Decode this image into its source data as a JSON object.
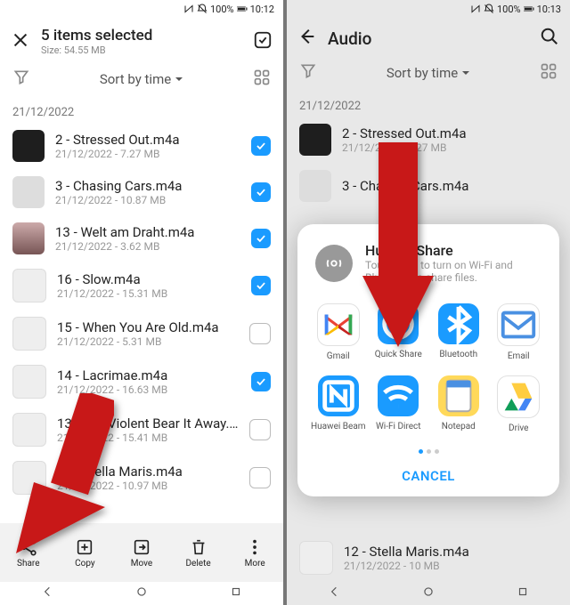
{
  "left": {
    "status": {
      "battery": "100%",
      "time": "10:12"
    },
    "header": {
      "title": "5 items selected",
      "subtitle": "Size: 54.55 MB"
    },
    "sort_label": "Sort by time",
    "date_group": "21/12/2022",
    "items": [
      {
        "name": "2 - Stressed Out.m4a",
        "meta": "21/12/2022 - 7.27 MB",
        "checked": true
      },
      {
        "name": "3 - Chasing Cars.m4a",
        "meta": "21/12/2022 - 10.87 MB",
        "checked": true
      },
      {
        "name": "13 - Welt am Draht.m4a",
        "meta": "21/12/2022 - 3.62 MB",
        "checked": true
      },
      {
        "name": "16 - Slow.m4a",
        "meta": "21/12/2022 - 15.31 MB",
        "checked": true
      },
      {
        "name": "15 - When You Are Old.m4a",
        "meta": "21/12/2022 - 5.31 MB",
        "checked": false
      },
      {
        "name": "14 - Lacrimae.m4a",
        "meta": "21/12/2022 - 16.63 MB",
        "checked": true
      },
      {
        "name": "13 - The Violent Bear It Away.m4a",
        "meta": "21/12/2022 - 15.41 MB",
        "checked": false
      },
      {
        "name": "12 - Stella Maris.m4a",
        "meta": "21/12/2022 - 10.97 MB",
        "checked": false
      }
    ],
    "bottom": {
      "share": "Share",
      "copy": "Copy",
      "move": "Move",
      "delete": "Delete",
      "more": "More"
    }
  },
  "right": {
    "status": {
      "battery": "100%",
      "time": "10:13"
    },
    "header": {
      "title": "Audio"
    },
    "sort_label": "Sort by time",
    "date_group": "21/12/2022",
    "items": [
      {
        "name": "2 - Stressed Out.m4a",
        "meta": "21/12/2022 - 7.27 MB"
      },
      {
        "name": "3 - Chasing Cars.m4a",
        "meta": ""
      },
      {
        "name": "12 - Stella Maris.m4a",
        "meta": "21/12/2022 - 10 MB"
      }
    ],
    "sheet": {
      "huawei_share_title": "Huawei Share",
      "huawei_share_sub": "Touch here to turn on Wi-Fi and Bluetooth to share files.",
      "apps": [
        {
          "name": "Gmail",
          "color": "#fff",
          "icon": "gmail"
        },
        {
          "name": "Quick Share",
          "color": "#1a9bff",
          "icon": "quickshare"
        },
        {
          "name": "Bluetooth",
          "color": "#1a9bff",
          "icon": "bluetooth"
        },
        {
          "name": "Email",
          "color": "#fff",
          "icon": "email"
        },
        {
          "name": "Huawei Beam",
          "color": "#1a9bff",
          "icon": "nfc"
        },
        {
          "name": "Wi-Fi Direct",
          "color": "#1a9bff",
          "icon": "wifi"
        },
        {
          "name": "Notepad",
          "color": "#ffd95a",
          "icon": "notepad"
        },
        {
          "name": "Drive",
          "color": "#fff",
          "icon": "drive"
        }
      ],
      "cancel": "CANCEL"
    }
  }
}
